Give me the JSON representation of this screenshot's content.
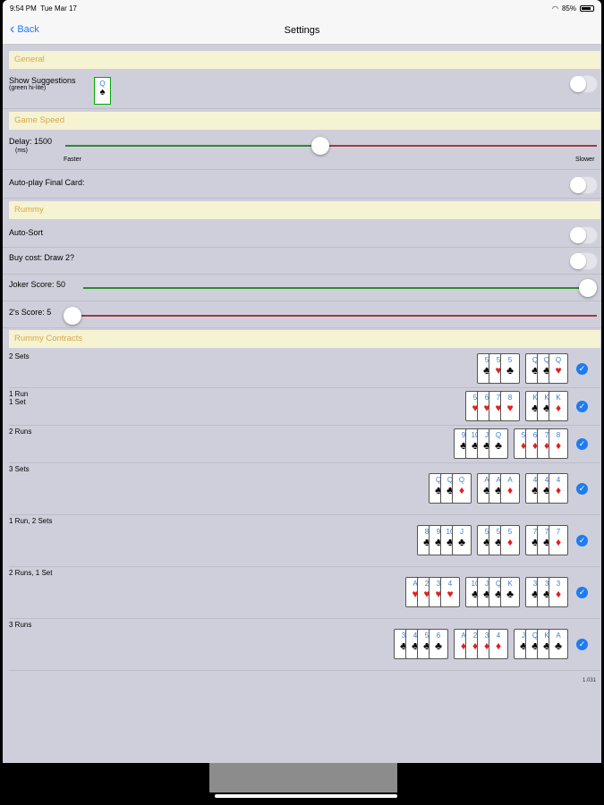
{
  "status": {
    "time": "9:54 PM",
    "date": "Tue Mar 17",
    "battery": "85%"
  },
  "nav": {
    "back_label": "Back",
    "title": "Settings"
  },
  "sections": {
    "general": "General",
    "game_speed": "Game Speed",
    "rummy": "Rummy",
    "rummy_contracts": "Rummy Contracts"
  },
  "general": {
    "show_suggestions": "Show Suggestions",
    "show_suggestions_sub": "(green hi-lite)",
    "suggestion_card": {
      "rank": "Q",
      "suit": "♠"
    },
    "show_suggestions_on": false
  },
  "game_speed": {
    "delay_label": "Delay: 1500",
    "delay_unit": "(ms)",
    "delay_value": 1500,
    "delay_fraction": 0.48,
    "min_label": "Faster",
    "max_label": "Slower",
    "autoplay_label": "Auto-play Final Card:",
    "autoplay_on": false
  },
  "rummy": {
    "autosort_label": "Auto-Sort",
    "autosort_on": false,
    "buy_cost_label": "Buy cost: Draw 2?",
    "buy_cost_on": false,
    "joker_label": "Joker Score:  50",
    "joker_fraction": 1.0,
    "twos_label": "2's Score:  5",
    "twos_fraction": 0.0
  },
  "contracts": [
    {
      "label": "2 Sets",
      "groups": [
        [
          {
            "r": "5",
            "s": "♣"
          },
          {
            "r": "5",
            "s": "♥"
          },
          {
            "r": "5",
            "s": "♣"
          }
        ],
        [
          {
            "r": "Q",
            "s": "♣"
          },
          {
            "r": "Q",
            "s": "♣"
          },
          {
            "r": "Q",
            "s": "♥"
          }
        ]
      ]
    },
    {
      "label": "1 Run\n1 Set",
      "groups": [
        [
          {
            "r": "5",
            "s": "♥"
          },
          {
            "r": "6",
            "s": "♥"
          },
          {
            "r": "7",
            "s": "♥"
          },
          {
            "r": "8",
            "s": "♥"
          }
        ],
        [
          {
            "r": "K",
            "s": "♣"
          },
          {
            "r": "K",
            "s": "♣"
          },
          {
            "r": "K",
            "s": "♦"
          }
        ]
      ]
    },
    {
      "label": "2 Runs",
      "groups": [
        [
          {
            "r": "9",
            "s": "♣"
          },
          {
            "r": "10",
            "s": "♣"
          },
          {
            "r": "J",
            "s": "♣"
          },
          {
            "r": "Q",
            "s": "♣"
          }
        ],
        [
          {
            "r": "5",
            "s": "♦"
          },
          {
            "r": "6",
            "s": "♦"
          },
          {
            "r": "7",
            "s": "♦"
          },
          {
            "r": "8",
            "s": "♦"
          }
        ]
      ]
    },
    {
      "label": "3 Sets",
      "groups": [
        [
          {
            "r": "Q",
            "s": "♣"
          },
          {
            "r": "Q",
            "s": "♣"
          },
          {
            "r": "Q",
            "s": "♦"
          }
        ],
        [
          {
            "r": "A",
            "s": "♣"
          },
          {
            "r": "A",
            "s": "♣"
          },
          {
            "r": "A",
            "s": "♦"
          }
        ],
        [
          {
            "r": "4",
            "s": "♣"
          },
          {
            "r": "4",
            "s": "♣"
          },
          {
            "r": "4",
            "s": "♦"
          }
        ]
      ]
    },
    {
      "label": "1 Run, 2 Sets",
      "groups": [
        [
          {
            "r": "8",
            "s": "♣"
          },
          {
            "r": "9",
            "s": "♣"
          },
          {
            "r": "10",
            "s": "♣"
          },
          {
            "r": "J",
            "s": "♣"
          }
        ],
        [
          {
            "r": "5",
            "s": "♣"
          },
          {
            "r": "5",
            "s": "♣"
          },
          {
            "r": "5",
            "s": "♦"
          }
        ],
        [
          {
            "r": "7",
            "s": "♣"
          },
          {
            "r": "7",
            "s": "♣"
          },
          {
            "r": "7",
            "s": "♦"
          }
        ]
      ]
    },
    {
      "label": "2 Runs, 1 Set",
      "groups": [
        [
          {
            "r": "A",
            "s": "♥"
          },
          {
            "r": "2",
            "s": "♥"
          },
          {
            "r": "3",
            "s": "♥"
          },
          {
            "r": "4",
            "s": "♥"
          }
        ],
        [
          {
            "r": "10",
            "s": "♣"
          },
          {
            "r": "J",
            "s": "♣"
          },
          {
            "r": "Q",
            "s": "♣"
          },
          {
            "r": "K",
            "s": "♣"
          }
        ],
        [
          {
            "r": "3",
            "s": "♣"
          },
          {
            "r": "3",
            "s": "♣"
          },
          {
            "r": "3",
            "s": "♦"
          }
        ]
      ]
    },
    {
      "label": "3 Runs",
      "groups": [
        [
          {
            "r": "3",
            "s": "♣"
          },
          {
            "r": "4",
            "s": "♣"
          },
          {
            "r": "5",
            "s": "♣"
          },
          {
            "r": "6",
            "s": "♣"
          }
        ],
        [
          {
            "r": "A",
            "s": "♦"
          },
          {
            "r": "2",
            "s": "♦"
          },
          {
            "r": "3",
            "s": "♦"
          },
          {
            "r": "4",
            "s": "♦"
          }
        ],
        [
          {
            "r": "J",
            "s": "♣"
          },
          {
            "r": "Q",
            "s": "♣"
          },
          {
            "r": "K",
            "s": "♣"
          },
          {
            "r": "A",
            "s": "♣"
          }
        ]
      ]
    }
  ],
  "version": "1.031",
  "colors": {
    "accent": "#1e7cf2",
    "section_bg": "#f5f3d2",
    "section_text": "#d6a94a",
    "slider_min": "#2c8a2c",
    "slider_max": "#a23a3a"
  }
}
